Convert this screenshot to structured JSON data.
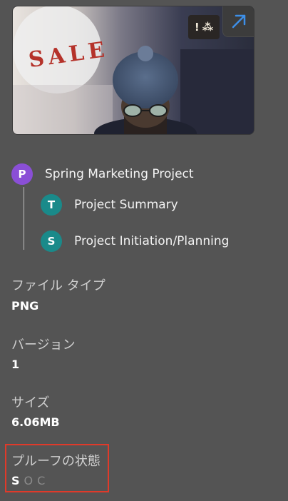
{
  "thumbnail": {
    "image_text": "SALE",
    "badge_glyphs": [
      "!",
      "⁂"
    ],
    "open_icon": "external-link-arrow-icon",
    "colors": {
      "open_arrow": "#3d8fe8",
      "sale_text": "#b5322a"
    }
  },
  "tree": {
    "project": {
      "initial": "P",
      "label": "Spring Marketing Project",
      "color": "#8a4fd6"
    },
    "children": [
      {
        "initial": "T",
        "label": "Project Summary",
        "color": "#1a8a8a"
      },
      {
        "initial": "S",
        "label": "Project Initiation/Planning",
        "color": "#1a8a8a"
      }
    ]
  },
  "properties": {
    "file_type": {
      "label": "ファイル タイプ",
      "value": "PNG"
    },
    "version": {
      "label": "バージョン",
      "value": "1"
    },
    "size": {
      "label": "サイズ",
      "value": "6.06MB"
    },
    "proof_status": {
      "label": "プルーフの状態",
      "states": [
        "S",
        "O",
        "C"
      ],
      "active_index": 0
    }
  },
  "colors": {
    "background": "#545454",
    "highlight_box": "#e03a2a"
  }
}
